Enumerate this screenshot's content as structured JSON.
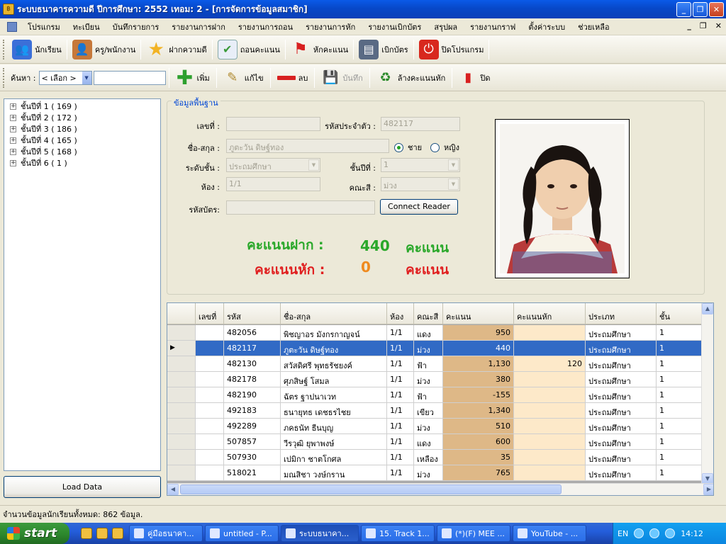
{
  "window": {
    "title": "ระบบธนาคารความดี ปีการศึกษา: 2552 เทอม: 2 - [การจัดการข้อมูลสมาชิก]",
    "buttons": {
      "minimize": "_",
      "restore": "❐",
      "close": "✕"
    }
  },
  "menubar": {
    "items": [
      "โปรแกรม",
      "ทะเบียน",
      "บันทึกรายการ",
      "รายงานการฝาก",
      "รายงานการถอน",
      "รายงานการหัก",
      "รายงานเบิกบัตร",
      "สรุปผล",
      "รายงานกราฟ",
      "ตั้งค่าระบบ",
      "ช่วยเหลือ"
    ],
    "mdi_controls": {
      "minimize": "_",
      "restore": "❐",
      "close": "✕"
    }
  },
  "toolbar_main": {
    "buttons": [
      {
        "label": "นักเรียน",
        "icon": "students-icon",
        "color": "#3b6fd8"
      },
      {
        "label": "ครู/พนักงาน",
        "icon": "staff-icon",
        "color": "#c6783a"
      },
      {
        "label": "ฝากความดี",
        "icon": "star-icon",
        "color": "#f2b324"
      },
      {
        "label": "ถอนคะแนน",
        "icon": "checklist-icon",
        "color": "#3a9a3a"
      },
      {
        "label": "หักคะแนน",
        "icon": "red-flag-icon",
        "color": "#d82020"
      },
      {
        "label": "เบิกบัตร",
        "icon": "card-icon",
        "color": "#5a6a84"
      },
      {
        "label": "ปิดโปรแกรม",
        "icon": "power-icon",
        "color": "#d8281e"
      }
    ]
  },
  "toolbar_records": {
    "search_label": "ค้นหา :",
    "search_select": "< เลือก >",
    "search_text": "",
    "buttons": [
      {
        "label": "เพิ่ม",
        "icon": "plus-icon",
        "enabled": true
      },
      {
        "label": "แก้ไข",
        "icon": "edit-icon",
        "enabled": true
      },
      {
        "label": "ลบ",
        "icon": "minus-icon",
        "enabled": true
      },
      {
        "label": "บันทึก",
        "icon": "save-icon",
        "enabled": false
      },
      {
        "label": "ล้างคะแนนหัก",
        "icon": "recycle-icon",
        "enabled": true
      },
      {
        "label": "ปิด",
        "icon": "close-doc-icon",
        "enabled": true
      }
    ]
  },
  "tree": {
    "nodes": [
      "ชั้นปีที่ 1 ( 169 )",
      "ชั้นปีที่ 2 ( 172 )",
      "ชั้นปีที่ 3 ( 186 )",
      "ชั้นปีที่ 4 ( 165 )",
      "ชั้นปีที่ 5 ( 168 )",
      "ชั้นปีที่ 6 ( 1 )"
    ]
  },
  "load_button": "Load Data",
  "form": {
    "group_label": "ข้อมูลพื้นฐาน",
    "labels": {
      "number": "เลขที่ :",
      "student_id": "รหัสประจำตัว :",
      "name": "ชื่อ-สกุล :",
      "level": "ระดับชั้น :",
      "grade": "ชั้นปีที่ :",
      "room": "ห้อง :",
      "color": "คณะสี :",
      "card": "รหัสบัตร:"
    },
    "values": {
      "number": "",
      "student_id": "482117",
      "name": "ภูตะวัน ดิษฐ์ทอง",
      "level": "ประถมศึกษา",
      "grade": "1",
      "room": "1/1",
      "color": "ม่วง",
      "card": ""
    },
    "gender": {
      "male": "ชาย",
      "female": "หญิง",
      "selected": "male"
    },
    "connect_button": "Connect Reader",
    "scores": {
      "deposit_label": "คะแนนฝาก :",
      "deposit_value": "440",
      "deposit_unit": "คะแนน",
      "deduct_label": "คะแนนหัก :",
      "deduct_value": "0",
      "deduct_unit": "คะแนน"
    }
  },
  "grid": {
    "columns": [
      "เลขที่",
      "รหัส",
      "ชื่อ-สกุล",
      "ห้อง",
      "คณะสี",
      "คะแนน",
      "คะแนนหัก",
      "ประเภท",
      "ชั้น"
    ],
    "rows": [
      {
        "no": "",
        "id": "482056",
        "name": "พิชญาอร มังกรกาญจน์",
        "room": "1/1",
        "color": "แดง",
        "score": "950",
        "deduct": "",
        "type": "ประถมศึกษา",
        "grade": "1"
      },
      {
        "no": "",
        "id": "482117",
        "name": "ภูตะวัน ดิษฐ์ทอง",
        "room": "1/1",
        "color": "ม่วง",
        "score": "440",
        "deduct": "",
        "type": "ประถมศึกษา",
        "grade": "1",
        "selected": true
      },
      {
        "no": "",
        "id": "482130",
        "name": "สวัสดิศรี พุทธรัชยงค์",
        "room": "1/1",
        "color": "ฟ้า",
        "score": "1,130",
        "deduct": "120",
        "type": "ประถมศึกษา",
        "grade": "1"
      },
      {
        "no": "",
        "id": "482178",
        "name": "ศุภสิษฐ์ โสมล",
        "room": "1/1",
        "color": "ม่วง",
        "score": "380",
        "deduct": "",
        "type": "ประถมศึกษา",
        "grade": "1"
      },
      {
        "no": "",
        "id": "482190",
        "name": "ฉัตร ฐาปนาเวท",
        "room": "1/1",
        "color": "ฟ้า",
        "score": "-155",
        "deduct": "",
        "type": "ประถมศึกษา",
        "grade": "1"
      },
      {
        "no": "",
        "id": "492183",
        "name": "ธนายุทธ เดชธรไชย",
        "room": "1/1",
        "color": "เขียว",
        "score": "1,340",
        "deduct": "",
        "type": "ประถมศึกษา",
        "grade": "1"
      },
      {
        "no": "",
        "id": "492289",
        "name": "ภคธนัท ธีนบุญ",
        "room": "1/1",
        "color": "ม่วง",
        "score": "510",
        "deduct": "",
        "type": "ประถมศึกษา",
        "grade": "1"
      },
      {
        "no": "",
        "id": "507857",
        "name": "วีรวุฒิ ยุพาพงษ์",
        "room": "1/1",
        "color": "แดง",
        "score": "600",
        "deduct": "",
        "type": "ประถมศึกษา",
        "grade": "1"
      },
      {
        "no": "",
        "id": "507930",
        "name": "เปมิกา ชาตโกศล",
        "room": "1/1",
        "color": "เหลือง",
        "score": "35",
        "deduct": "",
        "type": "ประถมศึกษา",
        "grade": "1"
      },
      {
        "no": "",
        "id": "518021",
        "name": "มณสิชา วงษ์กราน",
        "room": "1/1",
        "color": "ม่วง",
        "score": "765",
        "deduct": "",
        "type": "ประถมศึกษา",
        "grade": "1"
      }
    ]
  },
  "status": "จำนวนข้อมูลนักเรียนทั้งหมด: 862 ข้อมูล.",
  "taskbar": {
    "start": "start",
    "windows": [
      "คู่มือธนาคา...",
      "untitled - P...",
      "ระบบธนาคา...",
      "15. Track 1...",
      "(*)(F) MEE ...",
      "YouTube - ..."
    ],
    "active_window": 2,
    "lang": "EN",
    "clock": "14:12"
  }
}
